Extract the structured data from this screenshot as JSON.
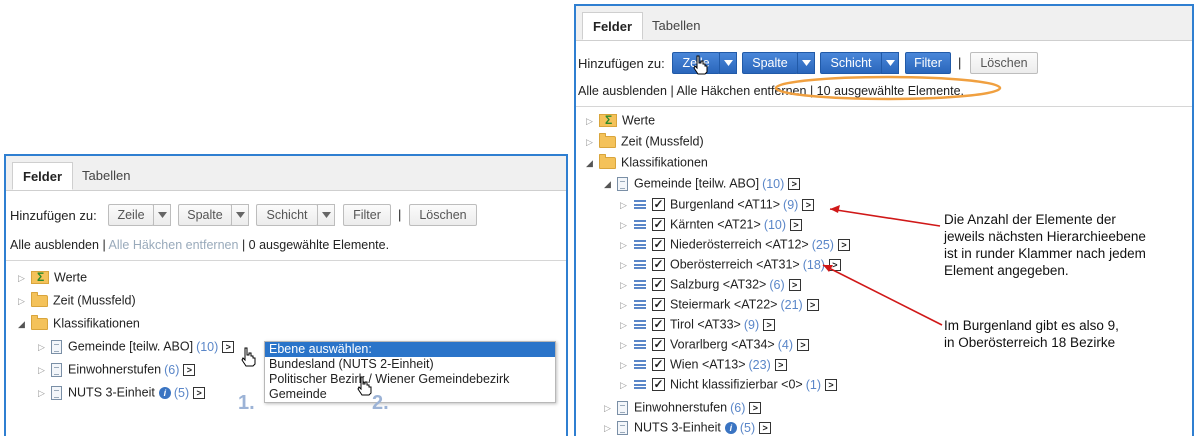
{
  "left_panel": {
    "tabs": [
      "Felder",
      "Tabellen"
    ],
    "toolbar": {
      "add_to_label": "Hinzufügen zu:",
      "buttons": [
        "Zeile",
        "Spalte",
        "Schicht"
      ],
      "filter": "Filter",
      "separator": "|",
      "delete": "Löschen"
    },
    "links": {
      "hide_all": "Alle ausblenden",
      "sep1": "|",
      "remove_checks": "Alle Häkchen entfernen",
      "sep2": "|",
      "selected": "0 ausgewählte Elemente."
    },
    "tree": {
      "werte": "Werte",
      "zeit": "Zeit (Mussfeld)",
      "klassifikationen": "Klassifikationen",
      "items": [
        {
          "label": "Gemeinde [teilw. ABO]",
          "count": "(10)",
          "arrow": ">"
        },
        {
          "label": "Einwohnerstufen",
          "count": "(6)",
          "arrow": ">"
        },
        {
          "label": "NUTS 3-Einheit",
          "info": "i",
          "count": "(5)",
          "arrow": ">"
        }
      ]
    },
    "dropdown": {
      "title": "Ebene auswählen:",
      "options": [
        "Bundesland (NUTS 2-Einheit)",
        "Politischer Bezirk / Wiener Gemeindebezirk",
        "Gemeinde"
      ]
    },
    "steps": [
      "1.",
      "2."
    ]
  },
  "right_panel": {
    "tabs": [
      "Felder",
      "Tabellen"
    ],
    "toolbar": {
      "add_to_label": "Hinzufügen zu:",
      "buttons": [
        "Zeile",
        "Spalte",
        "Schicht"
      ],
      "filter": "Filter",
      "separator": "|",
      "delete": "Löschen"
    },
    "links": {
      "hide_all": "Alle ausblenden",
      "sep1": "|",
      "remove_checks": "Alle Häkchen entfernen",
      "sep2": "|",
      "selected": "10 ausgewählte Elemente."
    },
    "tree": {
      "werte": "Werte",
      "zeit": "Zeit (Mussfeld)",
      "klassifikationen": "Klassifikationen",
      "gemeinde": {
        "label": "Gemeinde [teilw. ABO]",
        "count": "(10)",
        "arrow": ">"
      },
      "states": [
        {
          "label": "Burgenland <AT11>",
          "count": "(9)",
          "checked": "✓",
          "arrow": ">"
        },
        {
          "label": "Kärnten <AT21>",
          "count": "(10)",
          "checked": "✓",
          "arrow": ">"
        },
        {
          "label": "Niederösterreich <AT12>",
          "count": "(25)",
          "checked": "✓",
          "arrow": ">"
        },
        {
          "label": "Oberösterreich <AT31>",
          "count": "(18)",
          "checked": "✓",
          "arrow": ">"
        },
        {
          "label": "Salzburg <AT32>",
          "count": "(6)",
          "checked": "✓",
          "arrow": ">"
        },
        {
          "label": "Steiermark <AT22>",
          "count": "(21)",
          "checked": "✓",
          "arrow": ">"
        },
        {
          "label": "Tirol <AT33>",
          "count": "(9)",
          "checked": "✓",
          "arrow": ">"
        },
        {
          "label": "Vorarlberg <AT34>",
          "count": "(4)",
          "checked": "✓",
          "arrow": ">"
        },
        {
          "label": "Wien <AT13>",
          "count": "(23)",
          "checked": "✓",
          "arrow": ">"
        },
        {
          "label": "Nicht klassifizierbar <0>",
          "count": "(1)",
          "checked": "✓",
          "arrow": ">"
        }
      ],
      "after": [
        {
          "label": "Einwohnerstufen",
          "count": "(6)",
          "arrow": ">"
        },
        {
          "label": "NUTS 3-Einheit",
          "info": "i",
          "count": "(5)",
          "arrow": ">"
        }
      ]
    }
  },
  "annotations": {
    "note1": [
      "Die Anzahl der Elemente der",
      "jeweils nächsten Hierarchieebene",
      "ist in runder Klammer nach jedem",
      "Element angegeben."
    ],
    "note2": [
      "Im Burgenland gibt es also 9,",
      "in Oberösterreich 18 Bezirke"
    ]
  },
  "colors": {
    "panel_border": "#2f7fd1",
    "accent_blue": "#2a66bb",
    "highlight_orange": "#f0a040",
    "arrow_red": "#d01818",
    "count_blue": "#5a86c8"
  }
}
